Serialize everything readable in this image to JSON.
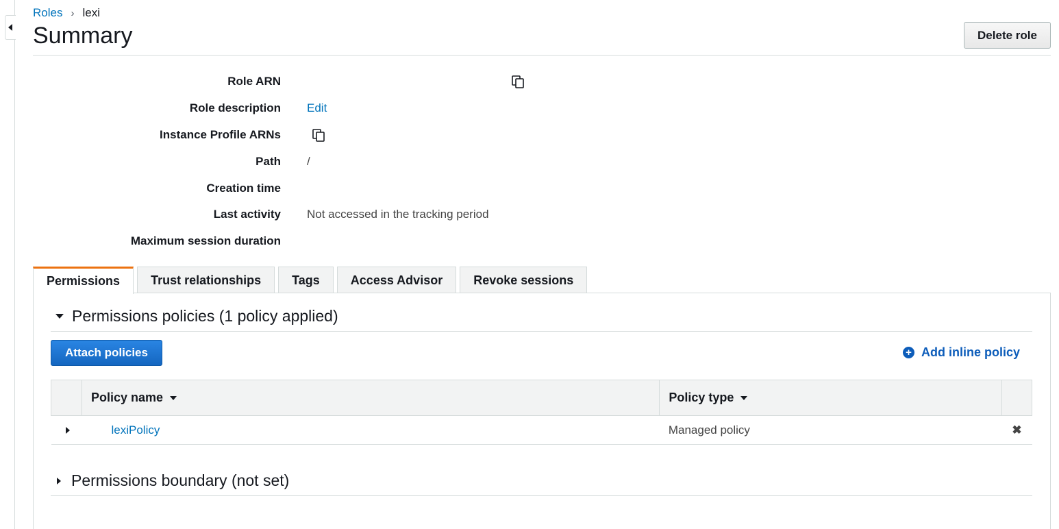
{
  "breadcrumb": {
    "parent": "Roles",
    "separator": "›",
    "current": "lexi"
  },
  "header": {
    "title": "Summary",
    "delete_label": "Delete role"
  },
  "summary": {
    "role_arn_label": "Role ARN",
    "role_description_label": "Role description",
    "role_description_action": "Edit",
    "instance_profile_label": "Instance Profile ARNs",
    "path_label": "Path",
    "path_value": "/",
    "creation_time_label": "Creation time",
    "last_activity_label": "Last activity",
    "last_activity_value": "Not accessed in the tracking period",
    "max_session_label": "Maximum session duration"
  },
  "tabs": [
    {
      "label": "Permissions",
      "active": true
    },
    {
      "label": "Trust relationships",
      "active": false
    },
    {
      "label": "Tags",
      "active": false
    },
    {
      "label": "Access Advisor",
      "active": false
    },
    {
      "label": "Revoke sessions",
      "active": false
    }
  ],
  "permissions": {
    "policies_heading": "Permissions policies (1 policy applied)",
    "attach_label": "Attach policies",
    "add_inline_label": "Add inline policy",
    "columns": [
      "Policy name",
      "Policy type"
    ],
    "rows": [
      {
        "name": "lexiPolicy",
        "type": "Managed policy"
      }
    ],
    "boundary_heading": "Permissions boundary (not set)"
  },
  "colors": {
    "link": "#0073bb",
    "active_tab_accent": "#ec7211",
    "primary_button": "#1977d4"
  },
  "icons": {
    "copy": "copy-icon",
    "add": "plus-circle-icon",
    "remove": "close-icon"
  }
}
